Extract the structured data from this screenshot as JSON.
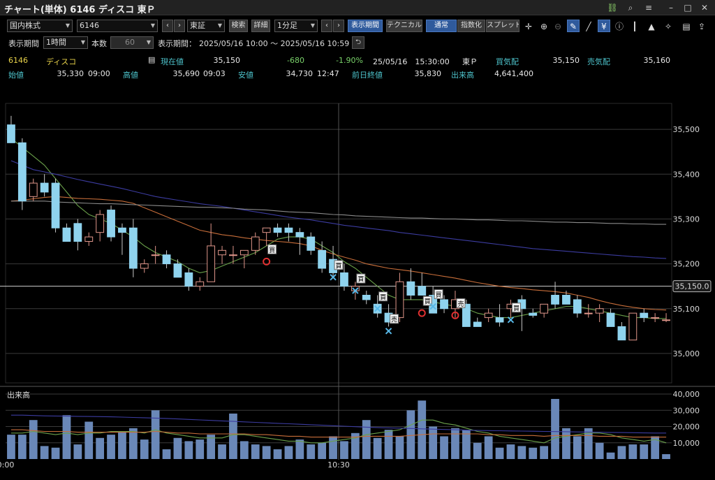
{
  "window": {
    "title": "チャート(単体) 6146 ディスコ 東Ｐ",
    "icons": [
      "link-icon",
      "search-icon",
      "menu-icon",
      "minimize-icon",
      "maximize-icon",
      "close-icon"
    ]
  },
  "toolbar1": {
    "market_select": "国内株式",
    "code_input": "6146",
    "exchange_select": "東証",
    "search_label": "検索",
    "detail_label": "詳細",
    "interval_select": "1分足",
    "display_period_label": "表示期間",
    "technical_label": "テクニカル",
    "normal_label": "通常",
    "index_label": "指数化",
    "spread_label": "スプレッド",
    "tool_icons": [
      "crosshair-icon",
      "zoom-in-icon",
      "zoom-out-icon",
      "pen-icon",
      "line-icon",
      "yen-icon",
      "info-icon",
      "candle-icon",
      "area-icon",
      "wrench-icon",
      "print-icon",
      "export-icon"
    ]
  },
  "toolbar2": {
    "period_label": "表示期間",
    "period_select": "1時間",
    "count_label": "本数",
    "count_value": "60",
    "range_label": "表示期間：",
    "range_value": "2025/05/16 10:00 ～ 2025/05/16 10:59"
  },
  "quote": {
    "code": "6146",
    "name": "ディスコ",
    "current_label": "現在値",
    "current_value": "35,150",
    "change": "-680",
    "change_pct": "-1.90%",
    "datetime": "25/05/16　15:30:00",
    "market": "東Ｐ",
    "bid_label": "買気配",
    "bid_value": "35,150",
    "ask_label": "売気配",
    "ask_value": "35,160",
    "open_label": "始値",
    "open_value": "35,330",
    "open_time": "09:00",
    "high_label": "高値",
    "high_value": "35,690",
    "high_time": "09:03",
    "low_label": "安値",
    "low_value": "34,730",
    "low_time": "12:47",
    "prev_close_label": "前日終値",
    "prev_close_value": "35,830",
    "volume_label": "出来高",
    "volume_value": "4,641,400"
  },
  "chart_data": {
    "type": "candlestick",
    "price_ylim": [
      34950,
      35550
    ],
    "price_ticks": [
      35000,
      35100,
      35200,
      35300,
      35400,
      35500
    ],
    "volume_ylim": [
      0,
      40000
    ],
    "volume_ticks": [
      10000,
      20000,
      30000,
      40000
    ],
    "volume_label": "出来高",
    "x_ticks": [
      {
        "index": -0.5,
        "label": "0:00"
      },
      {
        "index": 29.5,
        "label": "10:30"
      }
    ],
    "current_price_line": 35150,
    "current_price_label": "35,150.0",
    "ohlc": [
      [
        35510,
        35530,
        35480,
        35470
      ],
      [
        35470,
        35480,
        35320,
        35340
      ],
      [
        35350,
        35390,
        35340,
        35380
      ],
      [
        35380,
        35400,
        35350,
        35360
      ],
      [
        35380,
        35390,
        35270,
        35280
      ],
      [
        35280,
        35290,
        35250,
        35250
      ],
      [
        35290,
        35300,
        35230,
        35250
      ],
      [
        35250,
        35270,
        35240,
        35260
      ],
      [
        35270,
        35320,
        35250,
        35310
      ],
      [
        35320,
        35330,
        35250,
        35260
      ],
      [
        35280,
        35290,
        35220,
        35270
      ],
      [
        35280,
        35300,
        35170,
        35190
      ],
      [
        35190,
        35210,
        35180,
        35200
      ],
      [
        35220,
        35240,
        35200,
        35220
      ],
      [
        35220,
        35230,
        35190,
        35200
      ],
      [
        35200,
        35210,
        35170,
        35170
      ],
      [
        35180,
        35190,
        35140,
        35150
      ],
      [
        35150,
        35170,
        35140,
        35160
      ],
      [
        35160,
        35290,
        35160,
        35240
      ],
      [
        35220,
        35240,
        35200,
        35230
      ],
      [
        35220,
        35240,
        35200,
        35220
      ],
      [
        35220,
        35230,
        35190,
        35230
      ],
      [
        35230,
        35270,
        35220,
        35260
      ],
      [
        35270,
        35280,
        35240,
        35280
      ],
      [
        35280,
        35290,
        35260,
        35270
      ],
      [
        35280,
        35290,
        35250,
        35270
      ],
      [
        35270,
        35280,
        35220,
        35260
      ],
      [
        35260,
        35270,
        35220,
        35230
      ],
      [
        35230,
        35250,
        35180,
        35190
      ],
      [
        35210,
        35240,
        35170,
        35180
      ],
      [
        35180,
        35200,
        35140,
        35150
      ],
      [
        35140,
        35160,
        35120,
        35150
      ],
      [
        35130,
        35140,
        35110,
        35120
      ],
      [
        35110,
        35130,
        35080,
        35090
      ],
      [
        35090,
        35110,
        35060,
        35070
      ],
      [
        35080,
        35180,
        35070,
        35160
      ],
      [
        35160,
        35190,
        35120,
        35130
      ],
      [
        35150,
        35180,
        35130,
        35130
      ],
      [
        35130,
        35150,
        35090,
        35090
      ],
      [
        35120,
        35130,
        35090,
        35100
      ],
      [
        35100,
        35140,
        35080,
        35120
      ],
      [
        35110,
        35120,
        35060,
        35060
      ],
      [
        35070,
        35080,
        35060,
        35060
      ],
      [
        35080,
        35100,
        35070,
        35090
      ],
      [
        35080,
        35110,
        35060,
        35070
      ],
      [
        35100,
        35120,
        35080,
        35110
      ],
      [
        35120,
        35130,
        35050,
        35100
      ],
      [
        35090,
        35100,
        35080,
        35085
      ],
      [
        35090,
        35110,
        35080,
        35110
      ],
      [
        35130,
        35160,
        35100,
        35110
      ],
      [
        35130,
        35140,
        35110,
        35110
      ],
      [
        35120,
        35130,
        35080,
        35090
      ],
      [
        35090,
        35110,
        35080,
        35090
      ],
      [
        35090,
        35110,
        35070,
        35100
      ],
      [
        35090,
        35100,
        35060,
        35060
      ],
      [
        35060,
        35070,
        35030,
        35030
      ],
      [
        35030,
        35090,
        35030,
        35090
      ],
      [
        35090,
        35100,
        35070,
        35080
      ],
      [
        35080,
        35090,
        35070,
        35080
      ],
      [
        35075,
        35090,
        35070,
        35075
      ]
    ],
    "volume": [
      15000,
      15000,
      24000,
      8000,
      7000,
      27000,
      9000,
      23000,
      13000,
      15000,
      17000,
      19000,
      12000,
      30000,
      6000,
      13000,
      11000,
      12000,
      15000,
      9000,
      28000,
      11000,
      9000,
      8000,
      6000,
      8000,
      12000,
      9000,
      10000,
      14000,
      11000,
      16000,
      24000,
      13000,
      18000,
      14000,
      30000,
      36000,
      20000,
      14000,
      19000,
      18000,
      10000,
      14000,
      7000,
      9000,
      8000,
      7000,
      8000,
      37000,
      19000,
      14000,
      19000,
      10000,
      4000,
      8000,
      9000,
      9000,
      14000,
      3000
    ],
    "ma_series": [
      {
        "color": "#6aa04a",
        "values": [
          35480,
          35460,
          35440,
          35420,
          35390,
          35360,
          35330,
          35310,
          35300,
          35290,
          35275,
          35260,
          35240,
          35225,
          35215,
          35205,
          35190,
          35180,
          35185,
          35195,
          35205,
          35215,
          35225,
          35240,
          35255,
          35260,
          35260,
          35255,
          35240,
          35225,
          35205,
          35190,
          35170,
          35150,
          35130,
          35120,
          35120,
          35120,
          35115,
          35110,
          35105,
          35100,
          35090,
          35085,
          35080,
          35080,
          35085,
          35090,
          35095,
          35100,
          35105,
          35105,
          35100,
          35095,
          35090,
          35085,
          35080,
          35080,
          35078,
          35078
        ]
      },
      {
        "color": "#c86e3a",
        "values": [
          35340,
          35342,
          35345,
          35348,
          35350,
          35348,
          35346,
          35345,
          35344,
          35342,
          35340,
          35335,
          35325,
          35315,
          35305,
          35295,
          35285,
          35275,
          35270,
          35265,
          35262,
          35258,
          35255,
          35252,
          35250,
          35248,
          35245,
          35240,
          35230,
          35222,
          35215,
          35208,
          35200,
          35195,
          35190,
          35187,
          35184,
          35180,
          35176,
          35172,
          35168,
          35163,
          35158,
          35154,
          35150,
          35147,
          35145,
          35142,
          35140,
          35138,
          35135,
          35130,
          35125,
          35118,
          35112,
          35107,
          35103,
          35100,
          35098,
          35097
        ]
      },
      {
        "color": "#3c3ca0",
        "values": [
          35430,
          35420,
          35410,
          35405,
          35400,
          35394,
          35388,
          35383,
          35378,
          35373,
          35368,
          35362,
          35356,
          35350,
          35346,
          35342,
          35338,
          35334,
          35331,
          35328,
          35324,
          35320,
          35316,
          35312,
          35308,
          35304,
          35301,
          35298,
          35294,
          35290,
          35286,
          35283,
          35280,
          35277,
          35274,
          35270,
          35267,
          35264,
          35261,
          35258,
          35255,
          35252,
          35249,
          35246,
          35243,
          35240,
          35237,
          35234,
          35232,
          35230,
          35228,
          35226,
          35224,
          35222,
          35220,
          35218,
          35216,
          35215,
          35213,
          35212
        ]
      },
      {
        "color": "#8a8a8a",
        "values": [
          35340,
          35340,
          35340,
          35340,
          35338,
          35337,
          35336,
          35335,
          35334,
          35334,
          35333,
          35332,
          35331,
          35330,
          35329,
          35328,
          35327,
          35326,
          35326,
          35325,
          35324,
          35322,
          35321,
          35320,
          35318,
          35316,
          35315,
          35314,
          35312,
          35310,
          35309,
          35307,
          35306,
          35305,
          35304,
          35303,
          35302,
          35302,
          35301,
          35300,
          35300,
          35299,
          35298,
          35298,
          35297,
          35296,
          35296,
          35295,
          35294,
          35293,
          35293,
          35292,
          35292,
          35291,
          35290,
          35290,
          35289,
          35289,
          35288,
          35288
        ]
      }
    ],
    "vol_ma_series": [
      {
        "color": "#6aa04a",
        "values": [
          16000,
          16000,
          17000,
          16000,
          15000,
          16000,
          15000,
          16000,
          16000,
          17000,
          17000,
          17000,
          16000,
          18000,
          16000,
          15000,
          14000,
          13000,
          13000,
          13000,
          15000,
          15000,
          14000,
          13000,
          12000,
          11000,
          11000,
          10000,
          10000,
          11000,
          12000,
          13000,
          15000,
          16000,
          17000,
          18000,
          21000,
          24000,
          24000,
          22000,
          21000,
          19000,
          17000,
          16000,
          14000,
          13000,
          12000,
          11000,
          10000,
          13000,
          14000,
          15000,
          16000,
          16000,
          15000,
          13000,
          12000,
          11000,
          12000,
          10000
        ]
      },
      {
        "color": "#c86e3a",
        "values": [
          18000,
          18000,
          17500,
          17000,
          17000,
          17000,
          16500,
          16500,
          16500,
          16500,
          16500,
          16500,
          16500,
          17000,
          16500,
          16000,
          16000,
          15500,
          15500,
          15500,
          15500,
          15500,
          15000,
          15000,
          14500,
          14000,
          14000,
          13500,
          13500,
          13500,
          13500,
          13500,
          14000,
          14000,
          14000,
          14000,
          14500,
          15000,
          15500,
          15500,
          15500,
          15500,
          15500,
          15000,
          15000,
          14500,
          14500,
          14500,
          14000,
          14500,
          14500,
          14500,
          14500,
          14000,
          14000,
          14000,
          13500,
          13500,
          13500,
          13500
        ]
      },
      {
        "color": "#3c3ca0",
        "values": [
          27000,
          27000,
          26800,
          26600,
          26500,
          26400,
          26300,
          26200,
          26100,
          26000,
          25800,
          25600,
          25400,
          25200,
          25000,
          24700,
          24400,
          24100,
          23800,
          23500,
          23200,
          22900,
          22600,
          22300,
          22000,
          21700,
          21400,
          21100,
          20800,
          20500,
          20200,
          19900,
          19600,
          19400,
          19200,
          19000,
          18800,
          18600,
          18400,
          18200,
          18000,
          17800,
          17600,
          17500,
          17400,
          17300,
          17200,
          17100,
          17000,
          16900,
          16800,
          16700,
          16600,
          16500,
          16400,
          16300,
          16200,
          16100,
          16000,
          16000
        ]
      }
    ],
    "markers": [
      {
        "index": 23,
        "label": "買",
        "symbol": "○",
        "price": 35205
      },
      {
        "index": 29,
        "label": "買",
        "symbol": "×",
        "price": 35170
      },
      {
        "index": 31,
        "label": "買",
        "symbol": "×",
        "price": 35140
      },
      {
        "index": 33,
        "label": "買",
        "symbol": "×",
        "price": 35100
      },
      {
        "index": 34,
        "label": "売",
        "symbol": "×",
        "price": 35050
      },
      {
        "index": 37,
        "label": "買",
        "symbol": "○",
        "price": 35090
      },
      {
        "index": 38,
        "label": "買",
        "symbol": "×",
        "price": 35105
      },
      {
        "index": 40,
        "label": "売",
        "symbol": "○",
        "price": 35085
      },
      {
        "index": 45,
        "label": "買",
        "symbol": "×",
        "price": 35075
      }
    ],
    "crosshair_index": 29.5
  }
}
